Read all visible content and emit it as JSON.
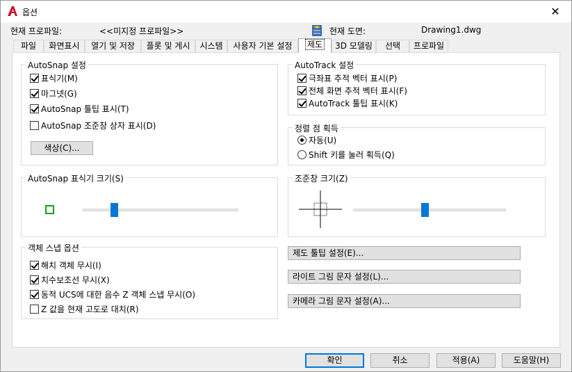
{
  "window": {
    "title": "옵션",
    "close_symbol": "✕"
  },
  "profile": {
    "current_profile_label": "현재 프로파일:",
    "current_profile_value": "<<미지정 프로파일>>",
    "current_drawing_label": "현재 도면:",
    "current_drawing_value": "Drawing1.dwg"
  },
  "tabs": [
    "파일",
    "화면표시",
    "열기 및 저장",
    "플롯 및 게시",
    "시스템",
    "사용자 기본 설정",
    "제도",
    "3D 모델링",
    "선택",
    "프로파일"
  ],
  "active_tab": "제도",
  "autosnap": {
    "title": "AutoSnap 설정",
    "marker": "표식기(M)",
    "magnet": "마그넷(G)",
    "tooltip": "AutoSnap 툴팁 표시(T)",
    "aperture_box": "AutoSnap 조준창 상자 표시(D)",
    "colors_button": "색상(C)...",
    "marker_checked": true,
    "magnet_checked": true,
    "tooltip_checked": true,
    "aperture_checked": false
  },
  "autotrack": {
    "title": "AutoTrack 설정",
    "polar": "극좌표 추적 벡터 표시(P)",
    "fullscreen": "전체 화면 추적 벡터 표시(F)",
    "tooltip": "AutoTrack 툴팁 표시(K)",
    "polar_checked": true,
    "fullscreen_checked": true,
    "tooltip_checked": true
  },
  "alignment": {
    "title": "정렬 점 획득",
    "automatic": "자동(U)",
    "shift": "Shift 키를 눌러 획득(Q)",
    "selected": "자동(U)"
  },
  "marker_size": {
    "title": "AutoSnap 표식기 크기(S)",
    "level": 0.2
  },
  "aperture_size": {
    "title": "조준창 크기(Z)",
    "level": 0.47
  },
  "object_snap": {
    "title": "객체 스냅 옵션",
    "ignore_hatch": "해치 객체 무시(I)",
    "ignore_dim": "치수보조선 무시(X)",
    "ignore_z": "동적 UCS에 대한 음수 Z 객체 스냅 무시(O)",
    "replace_z": "Z 값을 현재 고도로 대치(R)",
    "ignore_hatch_checked": true,
    "ignore_dim_checked": true,
    "ignore_z_checked": true,
    "replace_z_checked": false
  },
  "settings_buttons": {
    "drafting_tooltip": "제도 툴팁 설정(E)...",
    "light_glyph": "라이트 그림 문자 설정(L)...",
    "camera_glyph": "카메라 그림 문자 설정(A)..."
  },
  "footer": {
    "ok": "확인",
    "cancel": "취소",
    "apply": "적용(A)",
    "help": "도움말(H)"
  },
  "colors": {
    "accent": "#0078d7",
    "marker_green": "#1a9c1a",
    "app_red": "#c8102e"
  }
}
